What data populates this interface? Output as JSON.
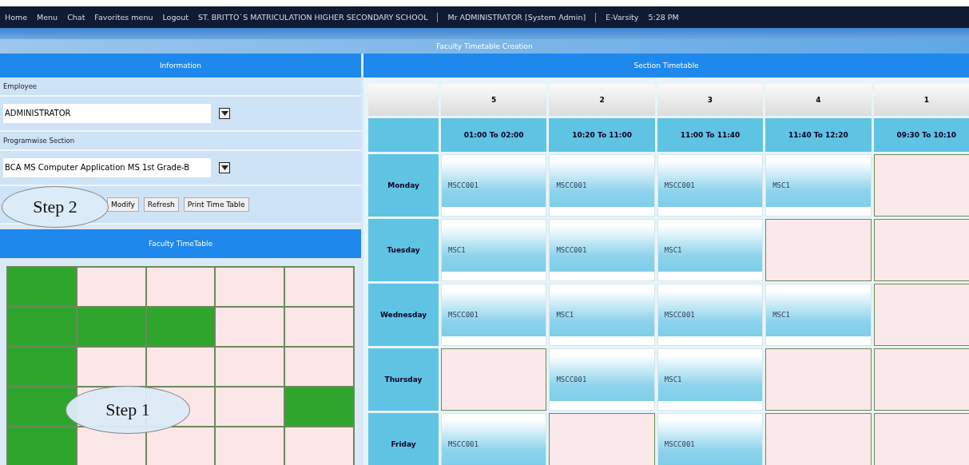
{
  "top_menu": [
    "Home",
    "Menu",
    "Chat",
    "Favorites menu",
    "Logout"
  ],
  "school": "ST. BRITTO`S MATRICULATION HIGHER SECONDARY SCHOOL",
  "user": "Mr ADMINISTRATOR [System Admin]",
  "app": "E-Varsity",
  "time": "5:28 PM",
  "page_title": "Faculty Timetable Creation",
  "information": {
    "title": "Information",
    "employee_label": "Employee",
    "employee": "ADMINISTRATOR",
    "section_label": "Programwise Section",
    "section": "BCA MS Computer Application MS 1st Grade-B",
    "buttons": [
      "Modify",
      "Refresh",
      "Print Time Table"
    ]
  },
  "faculty_timetable": {
    "title": "Faculty TimeTable",
    "grid": [
      [
        true,
        false,
        false,
        false,
        false
      ],
      [
        true,
        true,
        true,
        false,
        false
      ],
      [
        true,
        false,
        false,
        false,
        false
      ],
      [
        true,
        false,
        false,
        false,
        true
      ],
      [
        true,
        false,
        false,
        false,
        false
      ]
    ]
  },
  "callouts": [
    {
      "text": "Step 2",
      "kind": "step2"
    },
    {
      "text": "Step 1",
      "kind": "step1"
    }
  ],
  "section_timetable": {
    "title": "Section Timetable",
    "periods": [
      "5",
      "2",
      "3",
      "4",
      "1"
    ],
    "times": [
      "01:00 To 02:00",
      "10:20 To 11:00",
      "11:00 To 11:40",
      "11:40 To 12:20",
      "09:30 To 10:10"
    ],
    "rows": [
      {
        "day": "Monday",
        "cells": [
          {
            "kind": "subject",
            "text": "MSCC001"
          },
          {
            "kind": "subject",
            "text": "MSCC001"
          },
          {
            "kind": "subject",
            "text": "MSCC001"
          },
          {
            "kind": "subject",
            "text": "MSC1"
          },
          {
            "kind": "free"
          }
        ]
      },
      {
        "day": "Tuesday",
        "cells": [
          {
            "kind": "subject",
            "text": "MSC1"
          },
          {
            "kind": "subject",
            "text": "MSCC001"
          },
          {
            "kind": "subject",
            "text": "MSC1"
          },
          {
            "kind": "free"
          },
          {
            "kind": "free"
          }
        ]
      },
      {
        "day": "Wednesday",
        "cells": [
          {
            "kind": "subject",
            "text": "MSCC001"
          },
          {
            "kind": "subject",
            "text": "MSC1"
          },
          {
            "kind": "subject",
            "text": "MSCC001"
          },
          {
            "kind": "subject",
            "text": "MSC1"
          },
          {
            "kind": "free"
          }
        ]
      },
      {
        "day": "Thursday",
        "cells": [
          {
            "kind": "free"
          },
          {
            "kind": "subject",
            "text": "MSCC001"
          },
          {
            "kind": "subject",
            "text": "MSC1"
          },
          {
            "kind": "free"
          },
          {
            "kind": "free"
          }
        ]
      },
      {
        "day": "Friday",
        "cells": [
          {
            "kind": "subject",
            "text": "MSCC001"
          },
          {
            "kind": "free"
          },
          {
            "kind": "subject",
            "text": "MSCC001"
          },
          {
            "kind": "free"
          },
          {
            "kind": "free"
          }
        ]
      }
    ]
  }
}
